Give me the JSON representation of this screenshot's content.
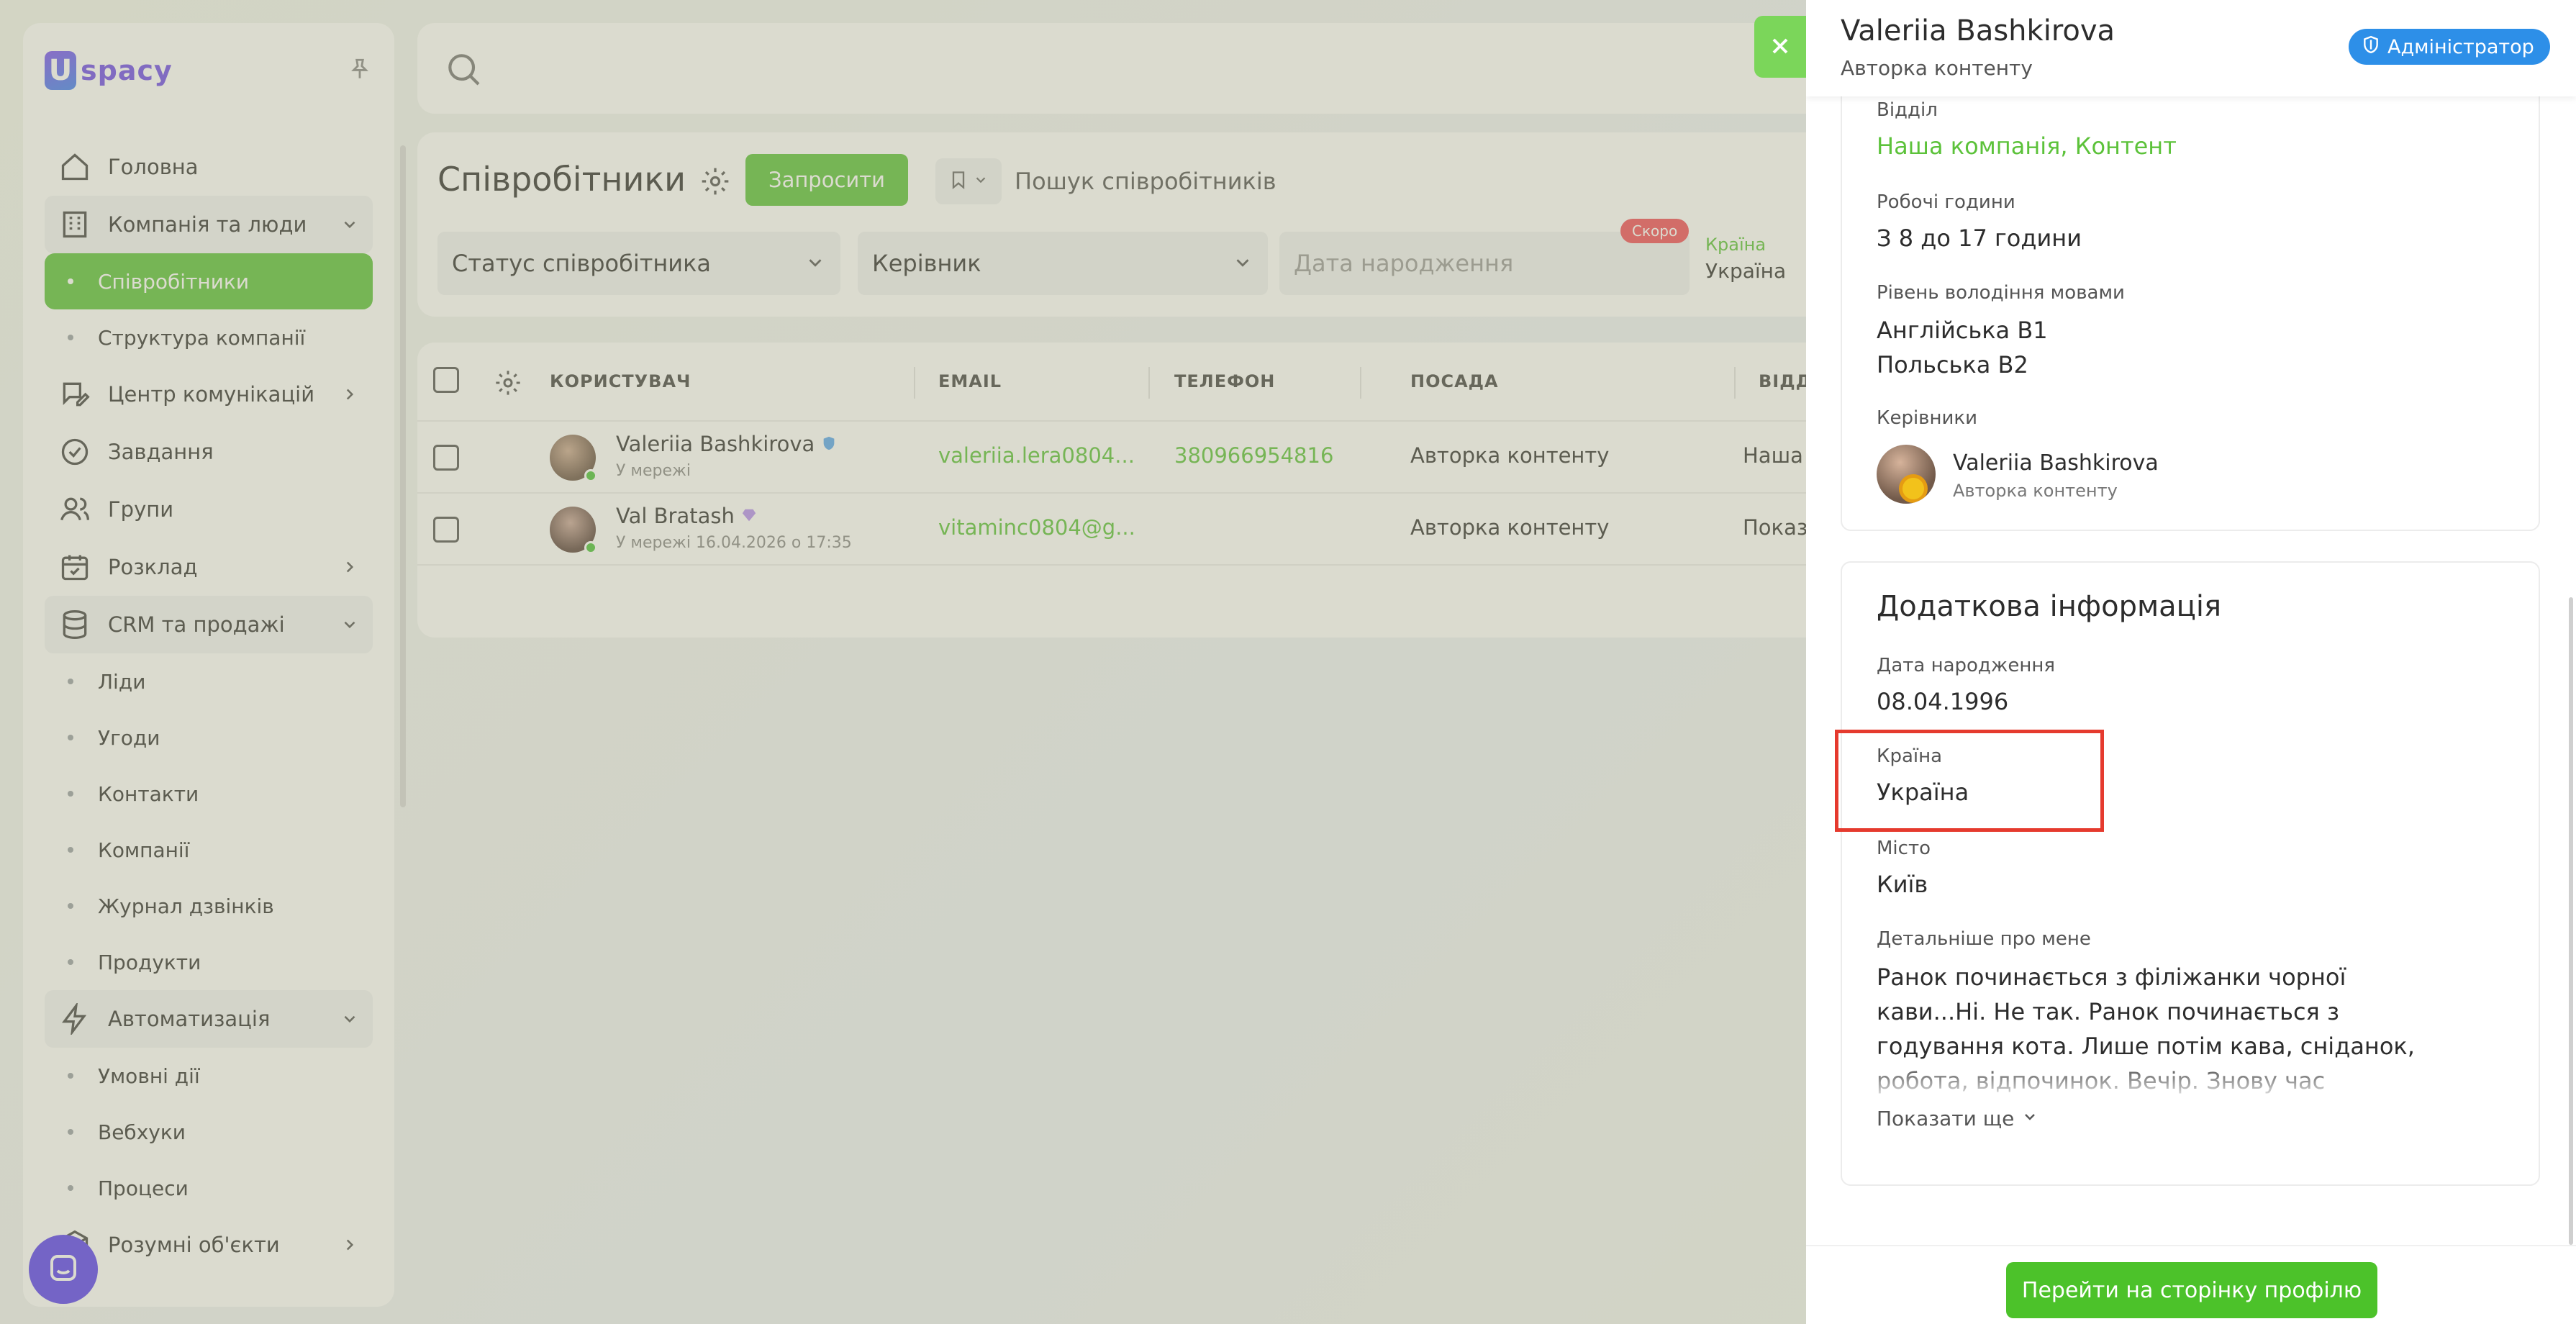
{
  "sidebar": {
    "logo_letter": "U",
    "logo_text": "spacy",
    "items": [
      {
        "label": "Головна",
        "icon": "home-icon"
      },
      {
        "label": "Компанія та люди",
        "icon": "building-icon"
      },
      {
        "label": "Співробітники"
      },
      {
        "label": "Структура компанії"
      },
      {
        "label": "Центр комунікацій",
        "icon": "chat-edit-icon"
      },
      {
        "label": "Завдання",
        "icon": "check-circle-icon"
      },
      {
        "label": "Групи",
        "icon": "users-icon"
      },
      {
        "label": "Розклад",
        "icon": "calendar-icon"
      },
      {
        "label": "CRM та продажі",
        "icon": "database-icon"
      },
      {
        "label": "Ліди"
      },
      {
        "label": "Угоди"
      },
      {
        "label": "Контакти"
      },
      {
        "label": "Компанії"
      },
      {
        "label": "Журнал дзвінків"
      },
      {
        "label": "Продукти"
      },
      {
        "label": "Автоматизація",
        "icon": "bolt-icon"
      },
      {
        "label": "Умовні дії"
      },
      {
        "label": "Вебхуки"
      },
      {
        "label": "Процеси"
      },
      {
        "label": "Розумні об'єкти",
        "icon": "cube-icon"
      }
    ]
  },
  "employees": {
    "title": "Співробітники",
    "invite_label": "Запросити",
    "search_placeholder": "Пошук співробітників",
    "filters": {
      "status": "Статус співробітника",
      "manager": "Керівник",
      "birthdate": "Дата народження",
      "soon_badge": "Скоро",
      "country_label": "Країна",
      "country_value": "Україна"
    },
    "columns": [
      "КОРИСТУВАЧ",
      "EMAIL",
      "ТЕЛЕФОН",
      "ПОСАДА",
      "ВІДД"
    ],
    "rows": [
      {
        "name": "Valeriia Bashkirova",
        "status": "У мережі",
        "email": "valeriia.lera0804...",
        "phone": "380966954816",
        "position": "Авторка контенту",
        "dept": "Наша"
      },
      {
        "name": "Val Bratash",
        "status": "У мережі 16.04.2026 о 17:35",
        "email": "vitaminc0804@g...",
        "phone": "",
        "position": "Авторка контенту",
        "dept": "Показ"
      }
    ]
  },
  "drawer": {
    "name": "Valeriia Bashkirova",
    "role": "Авторка контенту",
    "admin_badge": "Адміністратор",
    "department_label": "Відділ",
    "department_value": "Наша компанія, Контент",
    "hours_label": "Робочі години",
    "hours_value": "З 8 до 17 години",
    "languages_label": "Рівень володіння мовами",
    "languages": [
      "Англійська B1",
      "Польська B2"
    ],
    "managers_label": "Керівники",
    "manager_name": "Valeriia Bashkirova",
    "manager_role": "Авторка контенту",
    "extra_title": "Додаткова інформація",
    "birth_label": "Дата народження",
    "birth_value": "08.04.1996",
    "country_label": "Країна",
    "country_value": "Україна",
    "city_label": "Місто",
    "city_value": "Київ",
    "about_label": "Детальніше про мене",
    "about_text": "Ранок починається з філіжанки чорної кави...Ні. Не так. Ранок починається з годування кота. Лише потім кава, сніданок, робота, відпочинок. Вечір. Знову час",
    "show_more": "Показати ще",
    "profile_button": "Перейти на сторінку профілю"
  },
  "colors": {
    "accent_green": "#5cc23a",
    "admin_blue": "#2d8fe8",
    "highlight_red": "#e53a2e",
    "brand_purple": "#6f4be8"
  }
}
